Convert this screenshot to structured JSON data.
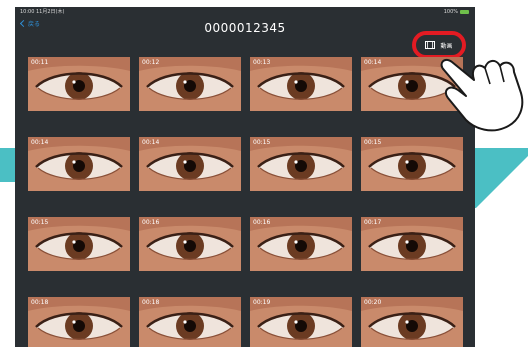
{
  "statusbar": {
    "left": "10:00 11月2日(木)",
    "right": "100%"
  },
  "nav": {
    "back_label": "戻る"
  },
  "header": {
    "title": "0000012345"
  },
  "toolbar": {
    "video_label": "動画"
  },
  "thumbnails": [
    [
      "00:11",
      "00:12",
      "00:13",
      "00:14"
    ],
    [
      "00:14",
      "00:14",
      "00:15",
      "00:15"
    ],
    [
      "00:15",
      "00:16",
      "00:16",
      "00:17"
    ],
    [
      "00:18",
      "00:18",
      "00:19",
      "00:20"
    ]
  ],
  "colors": {
    "background": "#2a2f33",
    "accent_blue": "#2f8fd6",
    "highlight_red": "#e31b23",
    "teal_band": "#4bbfc4"
  },
  "icons": {
    "video": "film-icon",
    "back": "chevron-left-icon",
    "pointer": "pointing-hand-icon"
  }
}
